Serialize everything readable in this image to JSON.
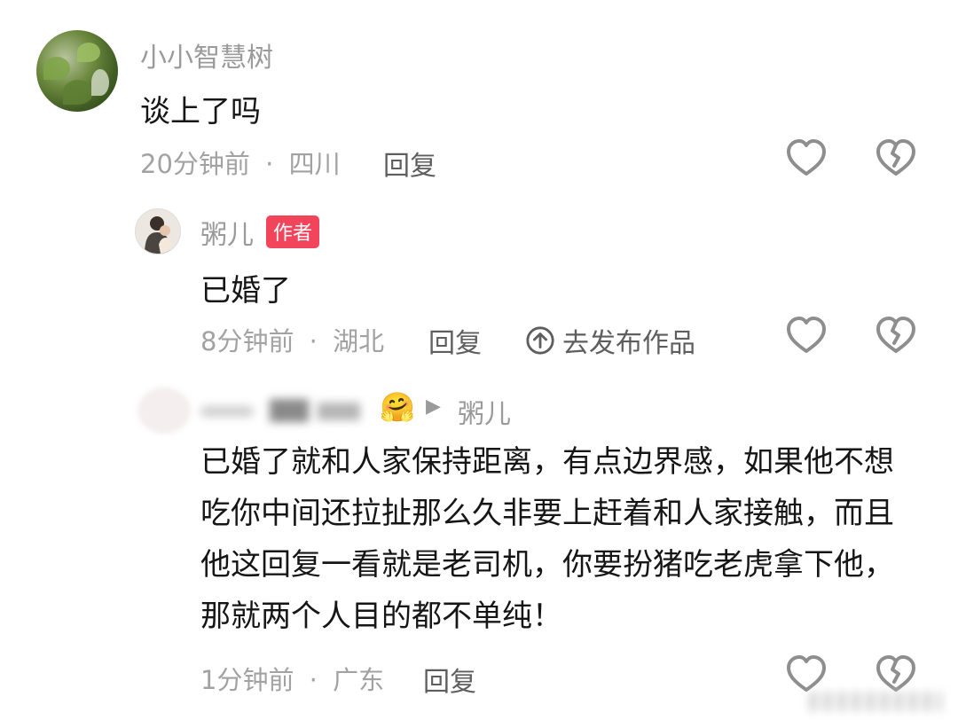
{
  "comments": [
    {
      "username": "小小智慧树",
      "text": "谈上了吗",
      "time": "20分钟前",
      "location": "四川",
      "reply_label": "回复"
    },
    {
      "username": "粥儿",
      "badge": "作者",
      "text": "已婚了",
      "time": "8分钟前",
      "location": "湖北",
      "reply_label": "回复",
      "publish_label": "去发布作品"
    },
    {
      "reply_to": "粥儿",
      "text": "已婚了就和人家保持距离，有点边界感，如果他不想吃你中间还拉扯那么久非要上赶着和人家接触，而且他这回复一看就是老司机，你要扮猪吃老虎拿下他，那就两个人目的都不单纯！",
      "time": "1分钟前",
      "location": "广东",
      "reply_label": "回复"
    }
  ],
  "separator": "·",
  "arrow": "▶",
  "emoji": "🤗",
  "colors": {
    "badge": "#f2455b",
    "muted": "#a2a2a2",
    "text": "#161616"
  },
  "icons": [
    "heart-outline-icon",
    "broken-heart-icon",
    "publish-arrow-up-icon"
  ]
}
